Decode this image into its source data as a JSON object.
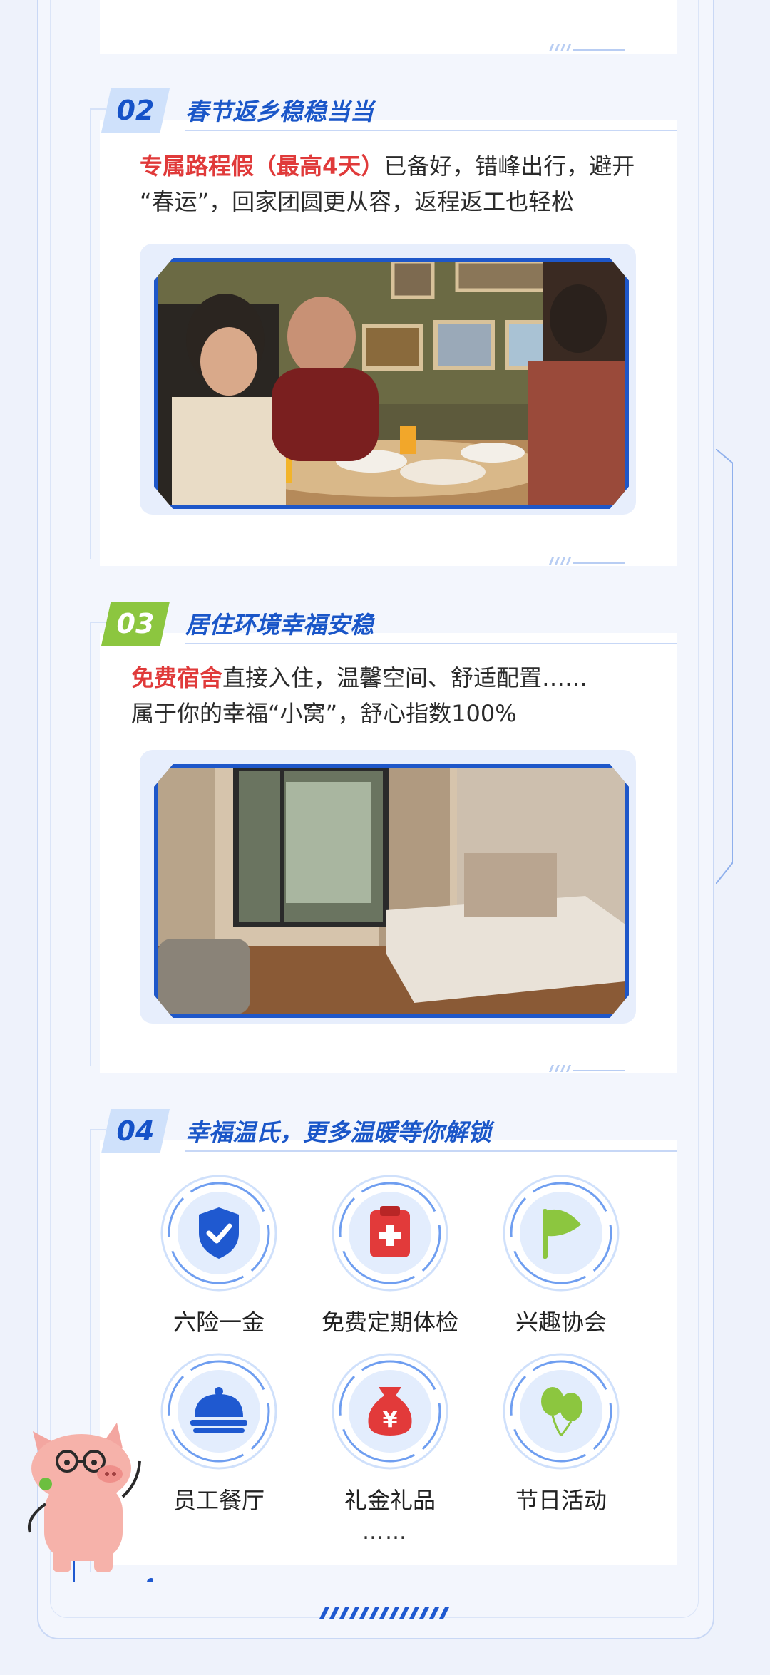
{
  "colors": {
    "accent_blue": "#1552c8",
    "highlight_red": "#e03a3a",
    "tag_blue_bg": "#cfe1fb",
    "tag_green_bg": "#8cc63f",
    "page_bg": "#eef2fb"
  },
  "sections": [
    {
      "number": "02",
      "title": "春节返乡稳稳当当",
      "highlight": "专属路程假（最高4天）",
      "line1_rest": "已备好，错峰出行，避开",
      "line2": "“春运”，回家团圆更从容，返程返工也轻松"
    },
    {
      "number": "03",
      "title": "居住环境幸福安稳",
      "highlight": "免费宿舍",
      "line1_rest": "直接入住，温馨空间、舒适配置……",
      "line2": "属于你的幸福“小窝”，舒心指数100%"
    },
    {
      "number": "04",
      "title": "幸福温氏，更多温暖等你解锁"
    }
  ],
  "benefits": [
    {
      "label": "六险一金",
      "icon": "shield-check-icon"
    },
    {
      "label": "免费定期体检",
      "icon": "medical-clipboard-icon"
    },
    {
      "label": "兴趣协会",
      "icon": "flag-icon"
    },
    {
      "label": "员工餐厅",
      "icon": "food-cloche-icon"
    },
    {
      "label": "礼金礼品",
      "icon": "money-bag-icon"
    },
    {
      "label": "节日活动",
      "icon": "balloons-icon"
    }
  ],
  "more": "……"
}
